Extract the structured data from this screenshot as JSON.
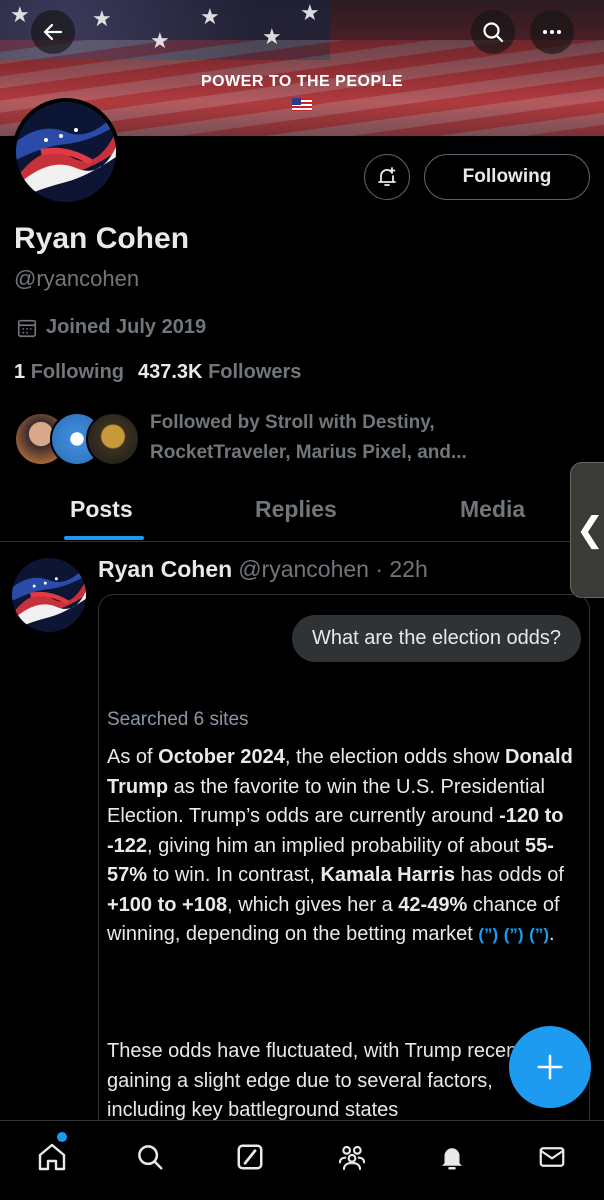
{
  "banner": {
    "title": "POWER TO THE PEOPLE",
    "back_icon": "arrow-left-icon",
    "search_icon": "search-icon",
    "more_icon": "more-horizontal-icon"
  },
  "profile": {
    "name": "Ryan Cohen",
    "handle": "@ryancohen",
    "joined": "Joined July 2019",
    "following_count": "1",
    "following_label": "Following",
    "followers_count": "437.3K",
    "followers_label": "Followers",
    "followed_by_line1": "Followed by Stroll with Destiny,",
    "followed_by_line2": "RocketTraveler, Marius Pixel, and...",
    "follow_button_label": "Following"
  },
  "tabs": [
    {
      "label": "Posts",
      "active": true
    },
    {
      "label": "Replies",
      "active": false
    },
    {
      "label": "Media",
      "active": false
    }
  ],
  "side_handle": "❮",
  "post": {
    "name": "Ryan Cohen",
    "meta": "@ryancohen · 22h",
    "question": "What are the election odds?",
    "searched": "Searched 6 sites",
    "para2": "These odds have fluctuated, with Trump recently gaining a slight edge due to several factors, including key battleground states"
  },
  "colors": {
    "accent": "#1d9bf0",
    "background": "#000000",
    "secondary_text": "#71767b"
  }
}
